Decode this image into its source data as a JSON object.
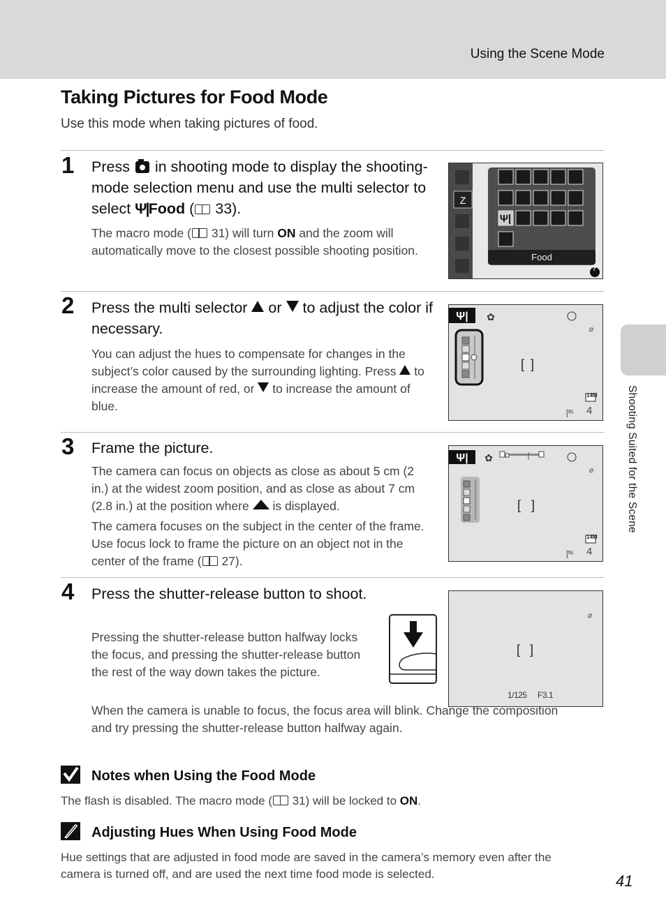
{
  "header": {
    "running_head": "Using the Scene Mode"
  },
  "side_tab": {
    "label": "Shooting Suited for the Scene"
  },
  "title": "Taking Pictures for Food Mode",
  "intro": "Use this mode when taking pictures of food.",
  "steps": [
    {
      "number": "1",
      "head_parts": [
        "Press",
        "in shooting mode to display the shooting-mode selection menu and use the multi selector to select",
        "Food",
        "(",
        "33)."
      ],
      "body": [
        {
          "parts": [
            "The macro mode (",
            "31) will turn",
            "ON",
            "and the zoom will automatically move to the closest possible shooting position."
          ]
        }
      ]
    },
    {
      "number": "2",
      "head_parts": [
        "Press the multi selector",
        "or",
        "to adjust the color if necessary."
      ],
      "body": [
        {
          "parts": [
            "You can adjust the hues to compensate for changes in the subject’s color caused by the surrounding lighting. Press",
            "to increase the amount of red, or",
            "to increase the amount of blue."
          ]
        }
      ]
    },
    {
      "number": "3",
      "head": "Frame the picture.",
      "body": [
        {
          "parts": [
            "The camera can focus on objects as close as about 5 cm (2 in.) at the widest zoom position, and as close as about 7 cm (2.8 in.) at the position where",
            "is displayed."
          ]
        },
        {
          "parts": [
            "The camera focuses on the subject in the center of the frame. Use focus lock to frame the picture on an object not in the center of the frame (",
            "27)."
          ]
        }
      ]
    },
    {
      "number": "4",
      "head": "Press the shutter-release button to shoot.",
      "body": [
        {
          "text": "Pressing the shutter-release button halfway locks the focus, and pressing the shutter-release button the rest of the way down takes the picture."
        },
        {
          "text": "When the camera is unable to focus, the focus area will blink. Change the composition and try pressing the shutter-release button halfway again."
        }
      ]
    }
  ],
  "screens": {
    "menu": {
      "selected_label": "Food",
      "help": "?"
    },
    "screen2": {
      "frame_count": "4",
      "image_size": "14M"
    },
    "screen3": {
      "frame_count": "4",
      "image_size": "14M"
    },
    "screen4": {
      "shutter": "1/125",
      "aperture": "F3.1"
    }
  },
  "notes": [
    {
      "icon": "check-icon",
      "head": "Notes when Using the Food Mode",
      "parts": [
        "The flash is disabled. The macro mode (",
        "31) will be locked to",
        "ON",
        "."
      ]
    },
    {
      "icon": "pencil-icon",
      "head": "Adjusting Hues When Using Food Mode",
      "text": "Hue settings that are adjusted in food mode are saved in the camera’s memory even after the camera is turned off, and are used the next time food mode is selected."
    }
  ],
  "page_number": "41"
}
